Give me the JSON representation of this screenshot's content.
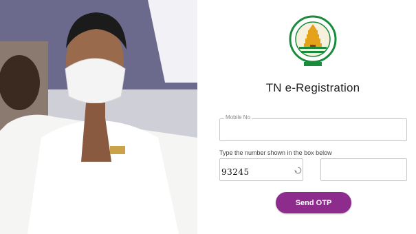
{
  "header": {
    "title": "TN e-Registration"
  },
  "form": {
    "mobile_label": "Mobile No",
    "mobile_value": "",
    "captcha_instruction": "Type the number shown in the box below",
    "captcha_code": "93245",
    "captcha_answer": ""
  },
  "actions": {
    "send_otp_label": "Send OTP"
  },
  "colors": {
    "button_bg": "#8e2c8e",
    "emblem_green": "#1a8a3c",
    "emblem_gold": "#e3a21a"
  },
  "icons": {
    "emblem": "tamil-nadu-emblem",
    "refresh": "refresh-icon"
  }
}
